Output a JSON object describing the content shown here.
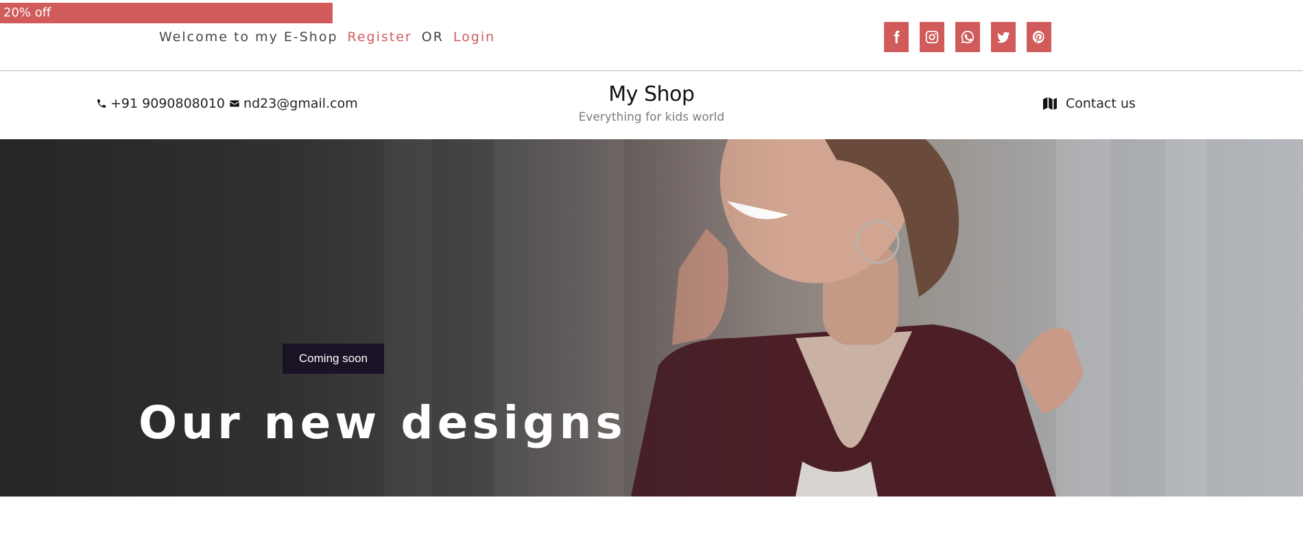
{
  "promo": {
    "text": "20% off"
  },
  "topbar": {
    "welcome": "Welcome to my E-Shop",
    "register": "Register",
    "or": "OR",
    "login": "Login"
  },
  "socials": [
    {
      "icon": "facebook-icon"
    },
    {
      "icon": "instagram-icon"
    },
    {
      "icon": "whatsapp-icon"
    },
    {
      "icon": "twitter-icon"
    },
    {
      "icon": "pinterest-icon"
    }
  ],
  "header": {
    "phone": "+91 9090808010",
    "email": "nd23@gmail.com",
    "brand_title": "My Shop",
    "brand_subtitle": "Everything for kids world",
    "contact": "Contact us"
  },
  "hero": {
    "badge": "Coming soon",
    "title": "Our new designs"
  },
  "colors": {
    "accent": "#d15b5b",
    "badge_bg": "#1a1325"
  }
}
